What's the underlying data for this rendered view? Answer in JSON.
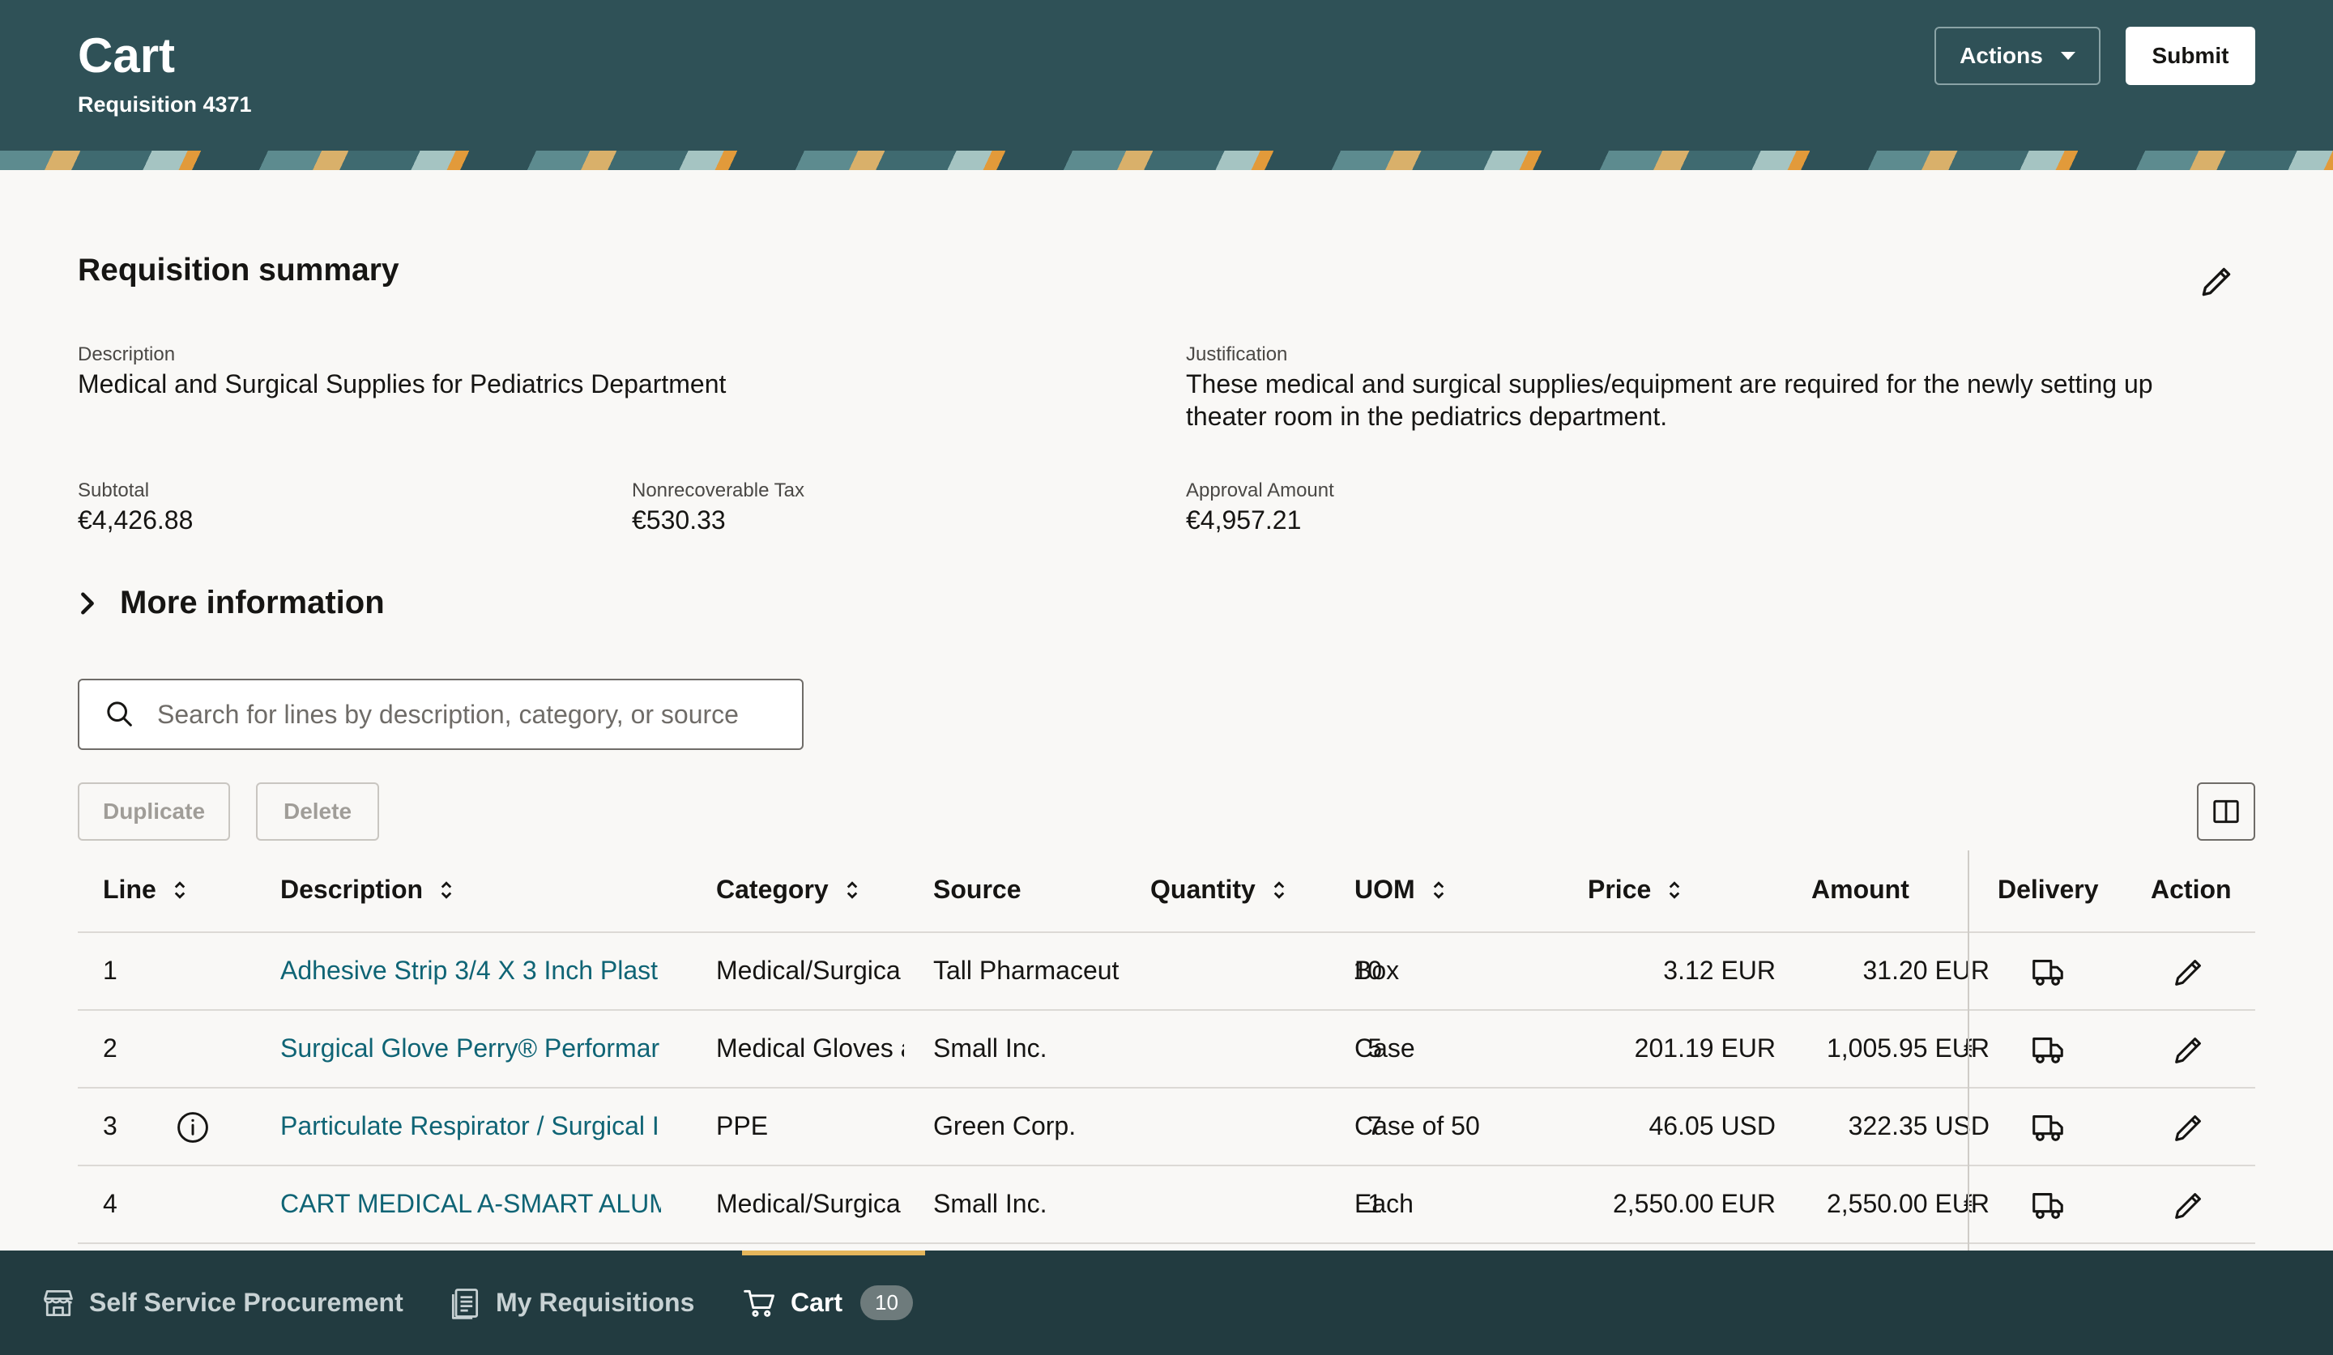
{
  "header": {
    "title": "Cart",
    "subtitle": "Requisition 4371",
    "actions_label": "Actions",
    "submit_label": "Submit"
  },
  "summary": {
    "title": "Requisition summary",
    "description_label": "Description",
    "description_value": "Medical and Surgical Supplies for Pediatrics Department",
    "justification_label": "Justification",
    "justification_line1": "These medical and surgical supplies/equipment are required for the newly setting up",
    "justification_line2": "theater room in the pediatrics department.",
    "subtotal_label": "Subtotal",
    "subtotal_value": "€4,426.88",
    "tax_label": "Nonrecoverable Tax",
    "tax_value": "€530.33",
    "approval_label": "Approval Amount",
    "approval_value": "€4,957.21",
    "more_info_label": "More information"
  },
  "search": {
    "placeholder": "Search for lines by description, category, or source"
  },
  "toolbar": {
    "duplicate_label": "Duplicate",
    "delete_label": "Delete"
  },
  "table": {
    "columns": {
      "line": "Line",
      "description": "Description",
      "category": "Category",
      "source": "Source",
      "quantity": "Quantity",
      "uom": "UOM",
      "price": "Price",
      "amount": "Amount",
      "delivery": "Delivery",
      "action": "Action"
    },
    "rows": [
      {
        "line": "1",
        "description": "Adhesive Strip 3/4 X 3 Inch Plast",
        "category": "Medical/Surgica",
        "source": "Tall Pharmaceut",
        "quantity": "10",
        "uom": "Box",
        "price": "3.12 EUR",
        "amount": "31.20 EUR",
        "overflow": "",
        "info": false
      },
      {
        "line": "2",
        "description": "Surgical Glove Perry® Performar",
        "category": "Medical Gloves a",
        "source": "Small Inc.",
        "quantity": "5",
        "uom": "Case",
        "price": "201.19 EUR",
        "amount": "1,005.95 EUR",
        "overflow": "€",
        "info": false
      },
      {
        "line": "3",
        "description": "Particulate Respirator / Surgical I",
        "category": "PPE",
        "source": "Green Corp.",
        "quantity": "7",
        "uom": "Case of 50",
        "price": "46.05 USD",
        "amount": "322.35 USD",
        "overflow": "",
        "info": true
      },
      {
        "line": "4",
        "description": "CART MEDICAL A-SMART ALUM",
        "category": "Medical/Surgica",
        "source": "Small Inc.",
        "quantity": "1",
        "uom": "Each",
        "price": "2,550.00 EUR",
        "amount": "2,550.00 EUR",
        "overflow": "€",
        "info": false
      }
    ]
  },
  "bottom_nav": {
    "items": [
      {
        "label": "Self Service Procurement",
        "icon": "store-icon"
      },
      {
        "label": "My Requisitions",
        "icon": "requisitions-icon"
      },
      {
        "label": "Cart",
        "icon": "cart-icon",
        "badge": "10"
      }
    ]
  },
  "colors": {
    "header_bg": "#2f5157",
    "nav_bg": "#223b40",
    "link": "#0f6475",
    "active_indicator": "#e5b65c"
  }
}
